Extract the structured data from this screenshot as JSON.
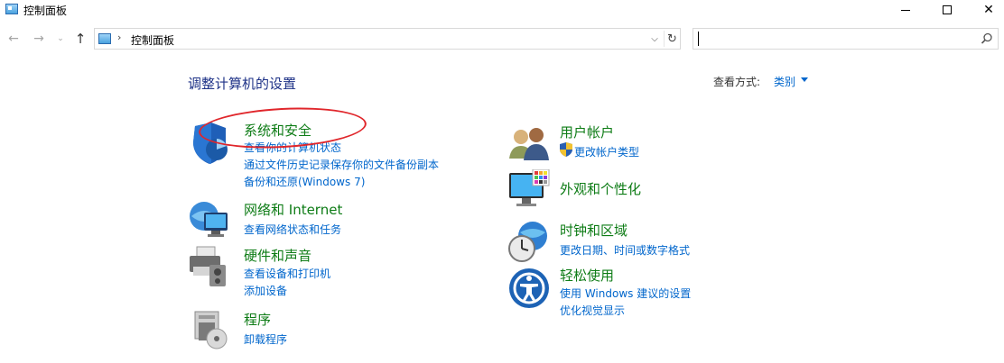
{
  "window": {
    "title": "控制面板"
  },
  "address_bar": {
    "path": "控制面板"
  },
  "search": {
    "value": "",
    "placeholder": ""
  },
  "header": {
    "title": "调整计算机的设置",
    "view_by_label": "查看方式:",
    "view_by_value": "类别"
  },
  "categories": {
    "system_security": {
      "title": "系统和安全",
      "links": [
        "查看你的计算机状态",
        "通过文件历史记录保存你的文件备份副本",
        "备份和还原(Windows 7)"
      ]
    },
    "network": {
      "title": "网络和 Internet",
      "links": [
        "查看网络状态和任务"
      ]
    },
    "hardware": {
      "title": "硬件和声音",
      "links": [
        "查看设备和打印机",
        "添加设备"
      ]
    },
    "programs": {
      "title": "程序",
      "links": [
        "卸载程序"
      ]
    },
    "user_accounts": {
      "title": "用户帐户",
      "links": [
        "更改帐户类型"
      ]
    },
    "appearance": {
      "title": "外观和个性化",
      "links": []
    },
    "clock_region": {
      "title": "时钟和区域",
      "links": [
        "更改日期、时间或数字格式"
      ]
    },
    "ease_of_access": {
      "title": "轻松使用",
      "links": [
        "使用 Windows 建议的设置",
        "优化视觉显示"
      ]
    }
  },
  "colors": {
    "category_title": "#0e7c16",
    "link": "#0066cc",
    "page_title": "#1e3287",
    "annotation": "#e0262b"
  }
}
